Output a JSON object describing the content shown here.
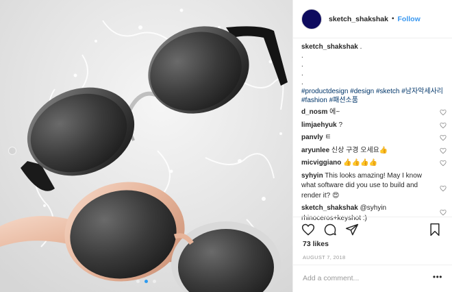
{
  "post": {
    "username": "sketch_shakshak",
    "separator": "•",
    "follow_label": "Follow",
    "caption": {
      "username": "sketch_shakshak",
      "text": " .",
      "dots": [
        ".",
        ".",
        ".",
        "."
      ],
      "hashtags": "#productdesign #design #sketch #남자악세사리 #fashion #패션소품"
    },
    "comments": [
      {
        "user": "d_nosm",
        "text": " 에~"
      },
      {
        "user": "limjaehyuk",
        "text": " ?"
      },
      {
        "user": "panvly",
        "text": " ㅌ"
      },
      {
        "user": "aryunlee",
        "text": " 신상 구경 오세요👍"
      },
      {
        "user": "micviggiano",
        "text": " 👍👍👍👍"
      },
      {
        "user": "syhyin",
        "text": " This looks amazing! May I know what software did you use to build and render it? 😍"
      },
      {
        "user": "sketch_shakshak",
        "text": " @syhyin rhinoceros+keyshot :)"
      }
    ],
    "likes": "73 likes",
    "date": "AUGUST 7, 2018",
    "add_comment_placeholder": "Add a comment...",
    "more_label": "•••",
    "icons": {
      "like": "heart-icon",
      "comment": "comment-bubble-icon",
      "share": "share-arrow-icon",
      "save": "bookmark-icon"
    },
    "colors": {
      "link": "#3897f0",
      "hashtag": "#003569",
      "avatar": "#0e0b5e",
      "carousel_active_dot": "#2e9bf0"
    },
    "carousel": {
      "slides": 3,
      "active": 1
    }
  }
}
